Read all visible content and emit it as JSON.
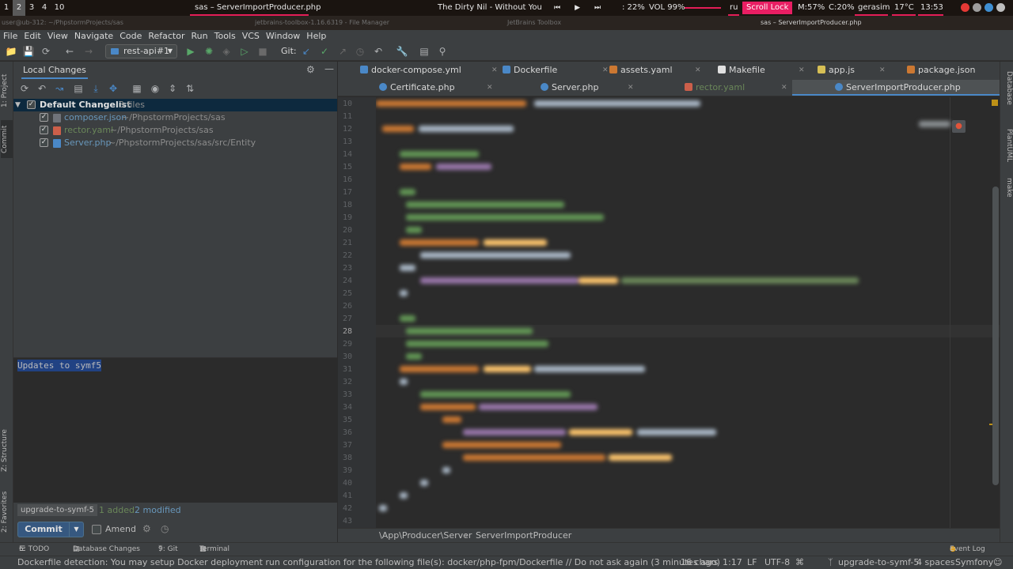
{
  "system_bar": {
    "workspaces": [
      "1",
      "2",
      "3",
      "4",
      "10"
    ],
    "active_workspace": "2",
    "window_title": "sas – ServerImportProducer.php",
    "now_playing": "The Dirty Nil - Without You",
    "cpu": ": 22%",
    "volume": "VOL 99%",
    "volume_level": 0.99,
    "language": "ru",
    "scroll_lock": "Scroll Lock",
    "memory": "M:57%",
    "cpu_load": "C:20%",
    "user": "gerasim",
    "temperature": "17°C",
    "time": "13:53"
  },
  "window_strip": {
    "terminal": "user@ub-312: ~/PhpstormProjects/sas",
    "toolbox": "jetbrains-toolbox-1.16.6319 - File Manager",
    "toolbox_center": "JetBrains Toolbox",
    "ide_title": "sas – ServerImportProducer.php"
  },
  "menu": {
    "items": [
      "File",
      "Edit",
      "View",
      "Navigate",
      "Code",
      "Refactor",
      "Run",
      "Tools",
      "VCS",
      "Window",
      "Help"
    ]
  },
  "toolbar": {
    "run_config": "rest-api#1",
    "git_label": "Git:"
  },
  "left_stripe": {
    "project": "1: Project",
    "commit": "Commit",
    "structure": "Z: Structure",
    "favorites": "2: Favorites"
  },
  "commit_panel": {
    "title": "Local Changes",
    "changelist": {
      "name": "Default Changelist",
      "count": "3 files"
    },
    "files": [
      {
        "name": "composer.json",
        "path": "~/PhpstormProjects/sas",
        "color": "#6897bb"
      },
      {
        "name": "rector.yaml",
        "path": "~/PhpstormProjects/sas",
        "color": "#6a8759"
      },
      {
        "name": "Server.php",
        "path": "~/PhpstormProjects/sas/src/Entity",
        "color": "#6897bb"
      }
    ],
    "commit_message": "Updates to symf5",
    "branch": "upgrade-to-symf-5",
    "added": "1 added",
    "modified": "2 modified",
    "commit_button": "Commit",
    "amend_label": "Amend"
  },
  "editor": {
    "tabs_row1": [
      {
        "label": "docker-compose.yml",
        "icon_color": "#4a88c7"
      },
      {
        "label": "Dockerfile",
        "icon_color": "#4a88c7"
      },
      {
        "label": "assets.yaml",
        "icon_color": "#cc7832"
      },
      {
        "label": "Makefile",
        "icon_color": "#e0e0e0"
      },
      {
        "label": "app.js",
        "icon_color": "#d6bf55"
      },
      {
        "label": "package.json",
        "icon_color": "#cc7832"
      }
    ],
    "tabs_row2": [
      {
        "label": "Certificate.php",
        "icon_color": "#4a88c7"
      },
      {
        "label": "Server.php",
        "icon_color": "#4a88c7"
      },
      {
        "label": "rector.yaml",
        "icon_color": "#cc5f4a"
      },
      {
        "label": "ServerImportProducer.php",
        "icon_color": "#4a88c7"
      }
    ],
    "line_numbers": [
      "10",
      "11",
      "12",
      "13",
      "14",
      "15",
      "16",
      "17",
      "18",
      "19",
      "20",
      "21",
      "22",
      "23",
      "24",
      "25",
      "26",
      "27",
      "28",
      "29",
      "30",
      "31",
      "32",
      "33",
      "34",
      "35",
      "36",
      "37",
      "38",
      "39",
      "40",
      "41",
      "42",
      "43"
    ],
    "current_line": "28",
    "breadcrumb": [
      "\\App\\Producer\\Server",
      "ServerImportProducer"
    ]
  },
  "right_stripe": {
    "database": "Database",
    "plantuml": "PlantUML",
    "make": "make"
  },
  "bottom_tools": {
    "todo": "6: TODO",
    "database_changes": "Database Changes",
    "git": "9: Git",
    "terminal": "Terminal",
    "event_log": "Event Log"
  },
  "status_bar": {
    "message": "Dockerfile detection: You may setup Docker deployment run configuration for the following file(s): docker/php-fpm/Dockerfile // Do not ask again (3 minutes ago)",
    "chars": "16 chars",
    "position": "1:17",
    "line_sep": "LF",
    "encoding": "UTF-8",
    "branch": "upgrade-to-symf-5",
    "indent": "4 spaces",
    "framework": "Symfony"
  }
}
